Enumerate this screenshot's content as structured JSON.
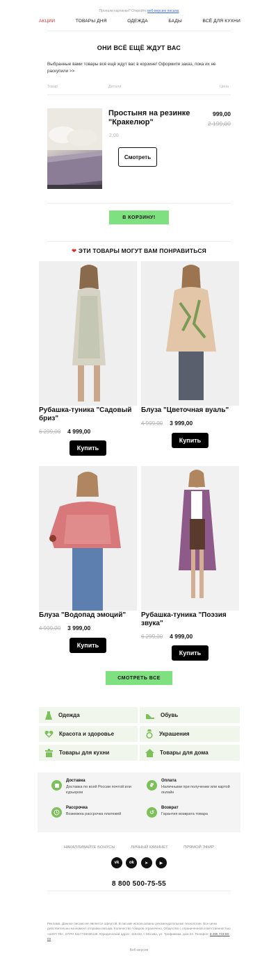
{
  "preheader": {
    "text": "Пропали картинки? Откройте",
    "link": "веб-версию письма"
  },
  "nav": [
    {
      "label": "АКЦИИ",
      "color": "#e0302a"
    },
    {
      "label": "ТОВАРЫ ДНЯ"
    },
    {
      "label": "ОДЕЖДА"
    },
    {
      "label": "БАДЫ"
    },
    {
      "label": "ВСЁ ДЛЯ КУХНИ"
    }
  ],
  "cart": {
    "heading": "ОНИ ВСЁ ЕЩЁ ЖДУТ ВАС",
    "intro": "Выбранные вами товары всё ещё ждут вас в корзине! Оформите заказ, пока их не раскупили >>",
    "columns": {
      "product": "Товар",
      "details": "Детали",
      "price": "Цена"
    },
    "item": {
      "title": "Простыня на резинке \"Кракелюр\"",
      "quantity": "2,00",
      "price": "999,00",
      "old_price": "2 199,00",
      "view_label": "Смотреть"
    },
    "cta": "В КОРЗИНУ!"
  },
  "recommend": {
    "heading": "ЭТИ ТОВАРЫ МОГУТ ВАМ ПОНРАВИТЬСЯ",
    "items": [
      {
        "title": "Рубашка-туника \"Садовый бриз\"",
        "old_price": "6 299,00",
        "price": "4 999,00",
        "buy": "Купить"
      },
      {
        "title": "Блуза \"Цветочная вуаль\"",
        "old_price": "4 999,00",
        "price": "3 999,00",
        "buy": "Купить"
      },
      {
        "title": "Блуза \"Водопад эмоций\"",
        "old_price": "4 999,00",
        "price": "3 999,00",
        "buy": "Купить"
      },
      {
        "title": "Рубашка-туника \"Поэзия звука\"",
        "old_price": "6 299,00",
        "price": "4 999,00",
        "buy": "Купить"
      }
    ],
    "see_all": "СМОТРЕТЬ ВСЕ"
  },
  "categories": [
    {
      "label": "Одежда",
      "icon": "dress-icon"
    },
    {
      "label": "Обувь",
      "icon": "shoe-icon"
    },
    {
      "label": "Красота и здоровье",
      "icon": "heart-plus-icon"
    },
    {
      "label": "Украшения",
      "icon": "ring-icon"
    },
    {
      "label": "Товары для кухни",
      "icon": "pot-icon"
    },
    {
      "label": "Товары для дома",
      "icon": "house-icon"
    }
  ],
  "info": [
    {
      "title": "Доставка",
      "text": "Доставка по всей России почтой или курьером",
      "icon": "box-icon"
    },
    {
      "title": "Оплата",
      "text": "Наличными при получении или картой онлайн",
      "icon": "ruble-icon"
    },
    {
      "title": "Рассрочка",
      "text": "Возможна рассрочка платежей",
      "icon": "clock-icon"
    },
    {
      "title": "Возврат",
      "text": "Гарантия возврата товара",
      "icon": "return-icon"
    }
  ],
  "footer": {
    "links": [
      "НАКАПЛИВАЙТЕ БОНУСЫ",
      "ЛИЧНЫЙ КАБИНЕТ",
      "ПРЯМОЙ ЭФИР"
    ],
    "social": [
      {
        "name": "vk-icon",
        "glyph": "vk"
      },
      {
        "name": "odnoklassniki-icon",
        "glyph": "ok"
      },
      {
        "name": "telegram-icon",
        "glyph": "➤"
      },
      {
        "name": "youtube-icon",
        "glyph": "▶"
      }
    ],
    "phone": "8 800 500-75-55",
    "legal": "Реклама. Данное письмо не является офертой. В письме использованы рекомендательные технологии. Все цены действительны на момент отправки письма. Количество товаров ограничено. Общество с ограниченной ответственностью «ШОП ТВ», ОГРН 5117746036128. Юридический адрес: 115432, г. Москва, ул. Трофимова, дом 24. Телефон:",
    "legal_phone": "8 495 733-96-03",
    "web_version": "Веб-версия"
  },
  "colors": {
    "accent_green": "#7ee07e",
    "sale_red": "#e0302a",
    "category_bg": "#f1f6ec"
  }
}
